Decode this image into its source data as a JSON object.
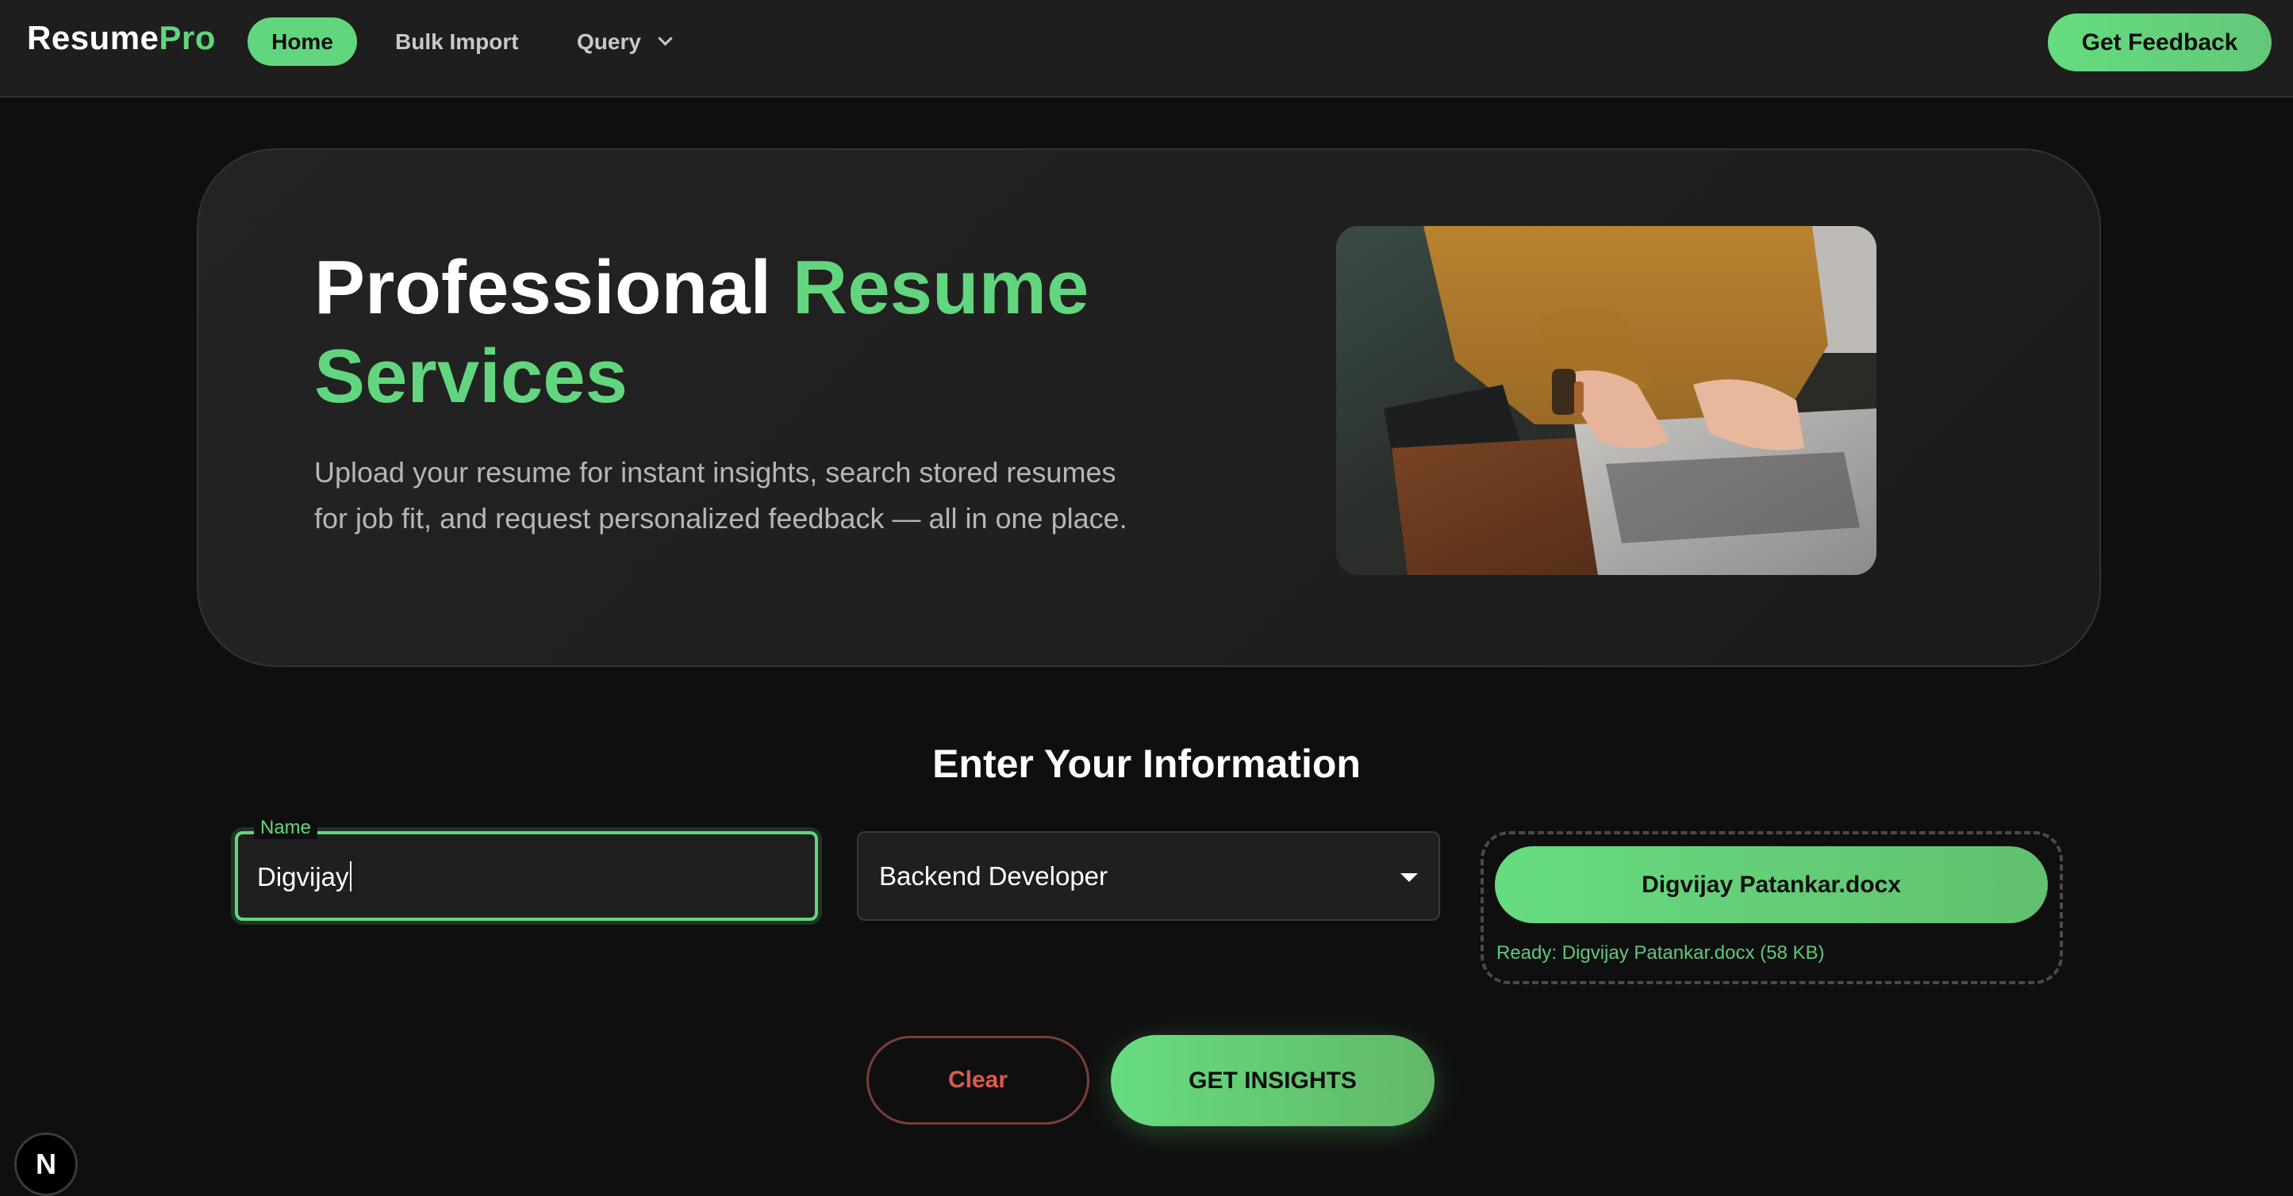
{
  "nav": {
    "logo_main": "Resume",
    "logo_accent": "Pro",
    "home": "Home",
    "bulk_import": "Bulk Import",
    "query": "Query",
    "get_feedback": "Get Feedback"
  },
  "hero": {
    "title_part1": "Professional ",
    "title_part2": "Resume Services",
    "subtitle": "Upload your resume for instant insights, search stored resumes for job fit, and request personalized feedback — all in one place."
  },
  "form": {
    "title": "Enter Your Information",
    "name_label": "Name",
    "name_value": "Digvijay",
    "role_value": "Backend Developer",
    "file_button": "Digvijay Patankar.docx",
    "file_status": "Ready: Digvijay Patankar.docx (58 KB)",
    "clear": "Clear",
    "get_insights": "GET INSIGHTS"
  },
  "corner_badge": "N",
  "colors": {
    "accent": "#62d67e",
    "background": "#0f0f0f",
    "danger": "#e05a4c"
  }
}
